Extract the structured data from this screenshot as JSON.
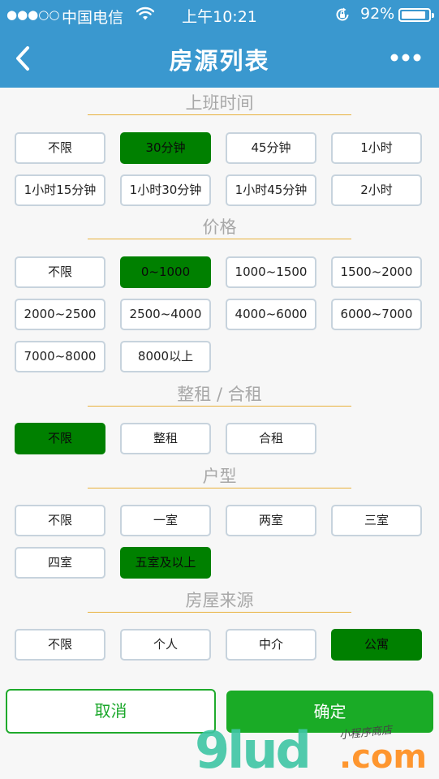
{
  "status_bar": {
    "signal": "●●●○○",
    "carrier": "中国电信",
    "time": "上午10:21",
    "battery_percent": "92%",
    "battery_level": 0.92,
    "icons": [
      "wifi-icon",
      "orientation-lock-icon",
      "battery-icon"
    ]
  },
  "nav": {
    "title": "房源列表",
    "back_icon": "chevron-left-icon",
    "more_icon": "more-dots-icon"
  },
  "sections": {
    "commute": {
      "title": "上班时间",
      "options": [
        "不限",
        "30分钟",
        "45分钟",
        "1小时",
        "1小时15分钟",
        "1小时30分钟",
        "1小时45分钟",
        "2小时"
      ],
      "selected": "30分钟"
    },
    "price": {
      "title": "价格",
      "options": [
        "不限",
        "0~1000",
        "1000~1500",
        "1500~2000",
        "2000~2500",
        "2500~4000",
        "4000~6000",
        "6000~7000",
        "7000~8000",
        "8000以上"
      ],
      "selected": "0~1000"
    },
    "rent_type": {
      "title": "整租 / 合租",
      "options": [
        "不限",
        "整租",
        "合租"
      ],
      "selected": "不限"
    },
    "layout": {
      "title": "户型",
      "options": [
        "不限",
        "一室",
        "两室",
        "三室",
        "四室",
        "五室及以上"
      ],
      "selected": "五室及以上"
    },
    "source": {
      "title": "房屋来源",
      "options": [
        "不限",
        "个人",
        "中介",
        "公寓"
      ],
      "selected": "公寓"
    }
  },
  "actions": {
    "cancel_label": "取消",
    "confirm_label": "确定"
  },
  "watermark": {
    "brand": "9lud",
    "domain": ".com",
    "tagline": "小程序商店"
  },
  "colors": {
    "header": "#3a98cf",
    "selected": "#008000",
    "divider": "#e8b13c",
    "confirm": "#1aab26"
  }
}
